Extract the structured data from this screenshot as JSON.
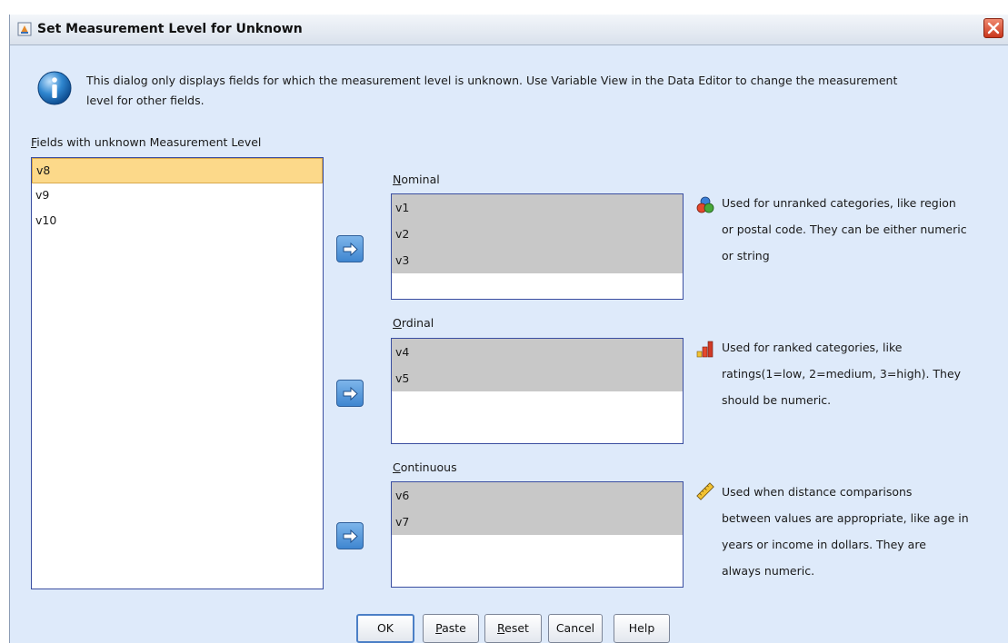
{
  "window": {
    "title": "Set Measurement Level for Unknown"
  },
  "info": {
    "line1": "This dialog only displays fields for which the measurement level is unknown. Use  Variable View in the Data Editor to change the measurement",
    "line2": "level for other fields."
  },
  "fields": {
    "label_accel": "F",
    "label_rest": "ields with unknown Measurement Level",
    "items": [
      "v8",
      "v9",
      "v10"
    ],
    "selected": "v8"
  },
  "nominal": {
    "label_accel": "N",
    "label_rest": "ominal",
    "items": [
      "v1",
      "v2",
      "v3"
    ],
    "desc": [
      "Used for unranked categories, like region",
      "or postal code. They can be either numeric",
      "or string"
    ],
    "icon": "nominal-venn-icon"
  },
  "ordinal": {
    "label_accel": "O",
    "label_rest": "rdinal",
    "items": [
      "v4",
      "v5"
    ],
    "desc": [
      "Used for ranked categories, like",
      "ratings(1=low, 2=medium, 3=high). They",
      "should be numeric."
    ],
    "icon": "ordinal-bars-icon"
  },
  "continuous": {
    "label_accel": "C",
    "label_rest": "ontinuous",
    "items": [
      "v6",
      "v7"
    ],
    "desc": [
      "Used when distance comparisons",
      "between values are appropriate, like age in",
      "years or income in dollars. They are",
      "always numeric."
    ],
    "icon": "ruler-icon"
  },
  "buttons": {
    "ok": "OK",
    "paste_accel": "P",
    "paste_rest": "aste",
    "reset_accel": "R",
    "reset_rest": "eset",
    "cancel": "Cancel",
    "help": "Help"
  },
  "colors": {
    "dialog_bg": "#deeafa",
    "list_border": "#3a4ea0",
    "selected_bg": "#fcd98a",
    "assigned_bg": "#c8c8c8",
    "arrow_button": "#3f86d0"
  }
}
